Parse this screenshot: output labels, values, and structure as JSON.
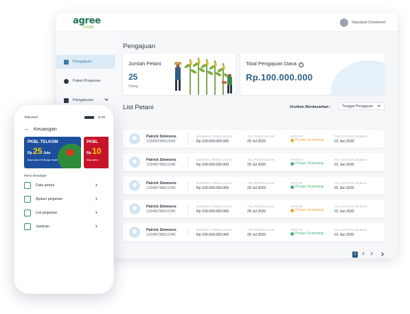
{
  "brand": {
    "logo_main": "agree",
    "logo_sub": "modal"
  },
  "header": {
    "user_name": "Standard Chartered"
  },
  "sidebar": {
    "items": [
      {
        "label": "Pengajuan",
        "active": true,
        "icon": "list-icon"
      },
      {
        "label": "Paket Pinjaman",
        "active": false,
        "icon": "package-icon"
      },
      {
        "label": "Pengaturan",
        "active": false,
        "icon": "settings-icon"
      }
    ]
  },
  "main": {
    "page_title": "Pengajuan",
    "summary": {
      "farmers": {
        "title": "Jumlah Petani",
        "value": "25",
        "unit": "Orang"
      },
      "total": {
        "title": "Total Pengajuan Dana",
        "value": "Rp.100.000.000"
      }
    },
    "list_title": "List Petani",
    "sort_label": "Urutkan Berdasarkan :",
    "sort_value": "Tanggal Pengajuan",
    "columns": {
      "nominal": "NOMINAL PENGAJUAN",
      "date": "TGL PENGAJUAN",
      "status": "STATUS",
      "changed": "TGL STATUS DIUBAH"
    },
    "rows": [
      {
        "name": "Patrick Simmons",
        "id": "123456789012345",
        "nominal": "Rp 100.000.000.000",
        "date": "29 Jul 2020",
        "status": "Proses Screening",
        "status_color": "#f2a12e",
        "changed": "01 Jan 2020"
      },
      {
        "name": "Patrick Simmons",
        "id": "123456789012345",
        "nominal": "Rp 100.000.000.000",
        "date": "29 Jul 2020",
        "status": "Proses Screening",
        "status_color": "#3bb273",
        "changed": "01 Jan 2020"
      },
      {
        "name": "Patrick Simmons",
        "id": "123456789012345",
        "nominal": "Rp 100.000.000.000",
        "date": "29 Jul 2020",
        "status": "Proses Screening",
        "status_color": "#3bb273",
        "changed": "01 Jan 2020"
      },
      {
        "name": "Patrick Simmons",
        "id": "123456789012345",
        "nominal": "Rp 100.000.000.000",
        "date": "29 Jul 2020",
        "status": "Proses Screening",
        "status_color": "#f2a12e",
        "changed": "01 Jan 2020"
      },
      {
        "name": "Patrick Simmons",
        "id": "123456789012345",
        "nominal": "Rp 100.000.000.000",
        "date": "29 Jul 2020",
        "status": "Proses Screening",
        "status_color": "#3bb273",
        "changed": "01 Jan 2020"
      }
    ],
    "pagination": {
      "pages": [
        "1",
        "2",
        "3"
      ],
      "current": "1"
    }
  },
  "mobile": {
    "status_carrier": "Telkomsel",
    "status_time": "11:00",
    "page_title": "Keuangan",
    "banner1": {
      "title": "PKBL TELKOM",
      "prefix": "Rp",
      "amount": "25",
      "suffix": "Juta",
      "small": "Biaya admin 0% Bunga rendah"
    },
    "banner2": {
      "title": "PKBL",
      "prefix": "Rp",
      "amount": "10",
      "small": "Biaya admin"
    },
    "menu_label": "Menu keuangan",
    "menu": [
      {
        "label": "Data petani",
        "icon": "document-user-icon"
      },
      {
        "label": "Ajukan pinjaman",
        "icon": "hand-money-icon"
      },
      {
        "label": "List pinjaman",
        "icon": "list-document-icon"
      },
      {
        "label": "Jaminan",
        "icon": "certificate-icon"
      }
    ]
  },
  "colors": {
    "primary": "#2c5f88",
    "brand_green": "#1d6f55",
    "pending": "#f2a12e",
    "success": "#3bb273"
  }
}
